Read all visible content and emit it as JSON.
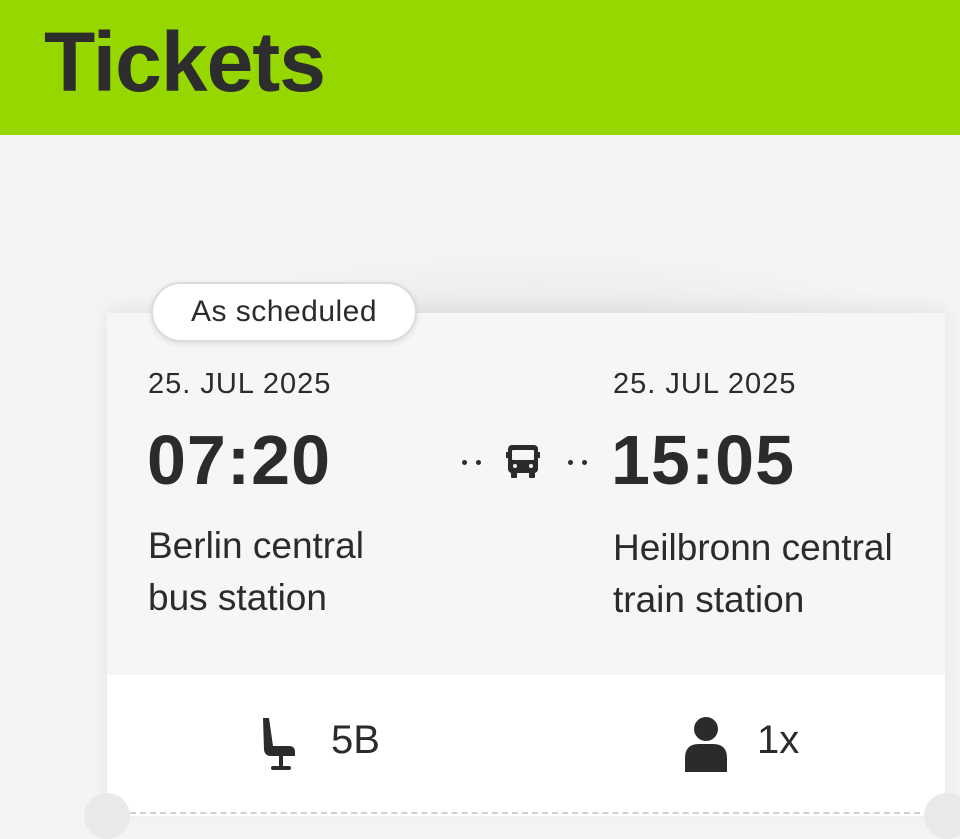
{
  "header": {
    "title": "Tickets",
    "background_color": "#97d700"
  },
  "ticket": {
    "status": "As scheduled",
    "departure": {
      "date": "25. JUL 2025",
      "time": "07:20",
      "station_line1": "Berlin central",
      "station_line2": "bus station"
    },
    "arrival": {
      "date": "25. JUL 2025",
      "time": "15:05",
      "station_line1": "Heilbronn central",
      "station_line2": "train station"
    },
    "transport_icon": "bus-icon",
    "seat": {
      "icon": "seat-icon",
      "label": "5B"
    },
    "passengers": {
      "icon": "person-icon",
      "label": "1x"
    }
  }
}
